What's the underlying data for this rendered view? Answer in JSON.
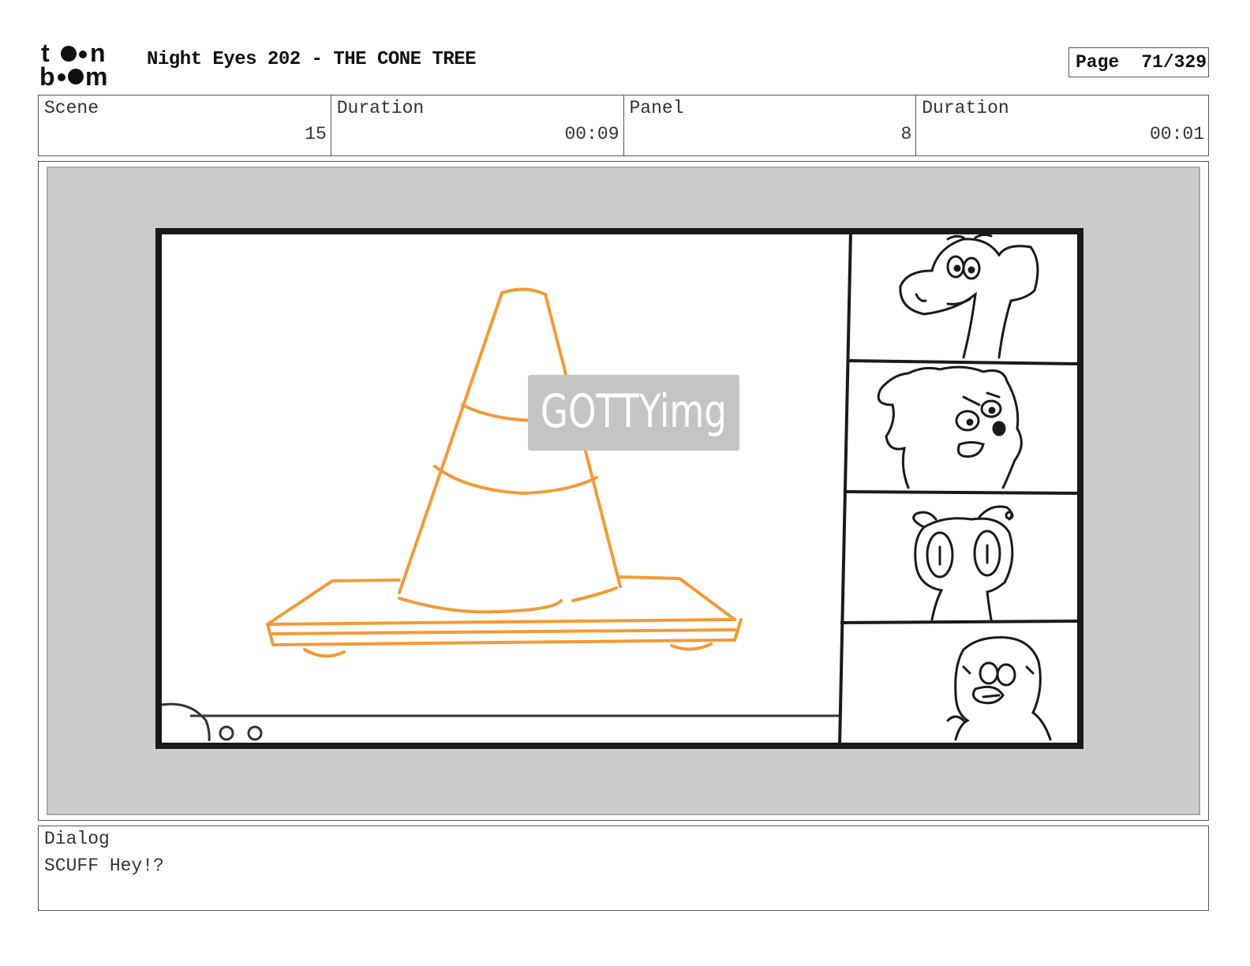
{
  "header": {
    "logo_text": "toon boom",
    "title": "Night Eyes 202 - THE CONE TREE",
    "page_label": "Page",
    "page_number": "71/329"
  },
  "info": {
    "scene_label": "Scene",
    "scene_value": "15",
    "scene_duration_label": "Duration",
    "scene_duration_value": "00:09",
    "panel_label": "Panel",
    "panel_value": "8",
    "panel_duration_label": "Duration",
    "panel_duration_value": "00:01"
  },
  "panel": {
    "watermark_text": "GOTTYimg",
    "cone_color": "#f39a36",
    "frame_color": "#1a1a1a",
    "background_color": "#cccccc"
  },
  "dialog": {
    "label": "Dialog",
    "text": "SCUFF Hey!?"
  }
}
